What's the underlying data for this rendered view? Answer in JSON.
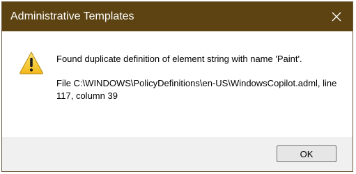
{
  "window": {
    "title": "Administrative Templates",
    "title_bar_color": "#5c4311"
  },
  "title_bar": {
    "close_icon": "close-icon"
  },
  "message": {
    "icon": "warning-icon",
    "main": "Found duplicate definition of element string with name 'Paint'.",
    "detail": "File C:\\WINDOWS\\PolicyDefinitions\\en-US\\WindowsCopilot.adml, line 117, column 39"
  },
  "buttons": {
    "ok_label": "OK"
  }
}
